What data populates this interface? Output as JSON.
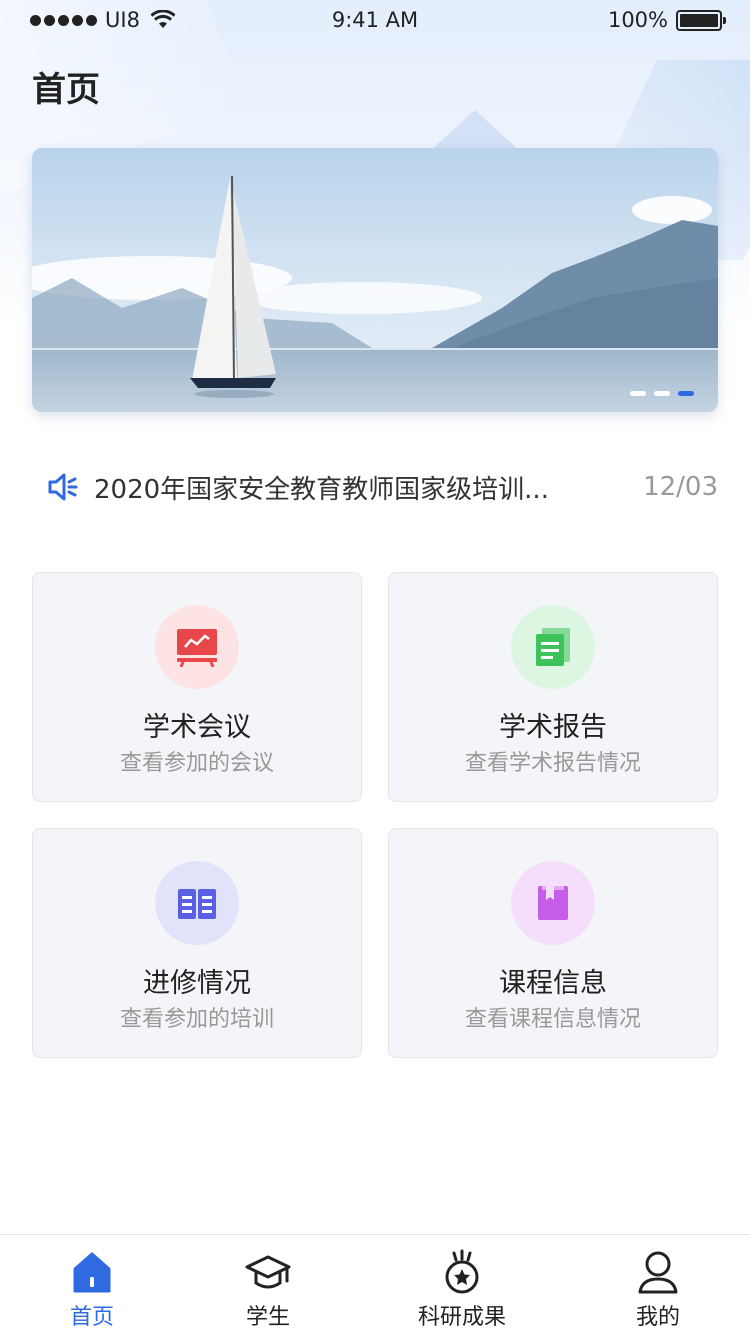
{
  "status_bar": {
    "carrier": "UI8",
    "time": "9:41 AM",
    "battery": "100%"
  },
  "page": {
    "title": "首页"
  },
  "banner": {
    "image": "sailboat-lake-mountains",
    "slides": 3,
    "active_slide": 3
  },
  "notice": {
    "icon": "speaker-icon",
    "text": "2020年国家安全教育教师国家级培训...",
    "date": "12/03"
  },
  "cards": [
    {
      "title": "学术会议",
      "subtitle": "查看参加的会议",
      "icon": "presentation-board-icon",
      "color": "#e8474a",
      "bg": "#fde3e3"
    },
    {
      "title": "学术报告",
      "subtitle": "查看学术报告情况",
      "icon": "report-document-icon",
      "color": "#3dc35a",
      "bg": "#ddf6e2"
    },
    {
      "title": "进修情况",
      "subtitle": "查看参加的培训",
      "icon": "open-book-icon",
      "color": "#5b5fe3",
      "bg": "#e2e2fb"
    },
    {
      "title": "课程信息",
      "subtitle": "查看课程信息情况",
      "icon": "bookmark-book-icon",
      "color": "#c55de8",
      "bg": "#f5defb"
    }
  ],
  "tab_bar": {
    "items": [
      {
        "label": "首页",
        "icon": "home-icon",
        "active": true
      },
      {
        "label": "学生",
        "icon": "graduation-cap-icon",
        "active": false
      },
      {
        "label": "科研成果",
        "icon": "medal-icon",
        "active": false
      },
      {
        "label": "我的",
        "icon": "person-icon",
        "active": false
      }
    ]
  },
  "colors": {
    "accent": "#2f6ae0",
    "card_bg": "#f3f5f8"
  }
}
